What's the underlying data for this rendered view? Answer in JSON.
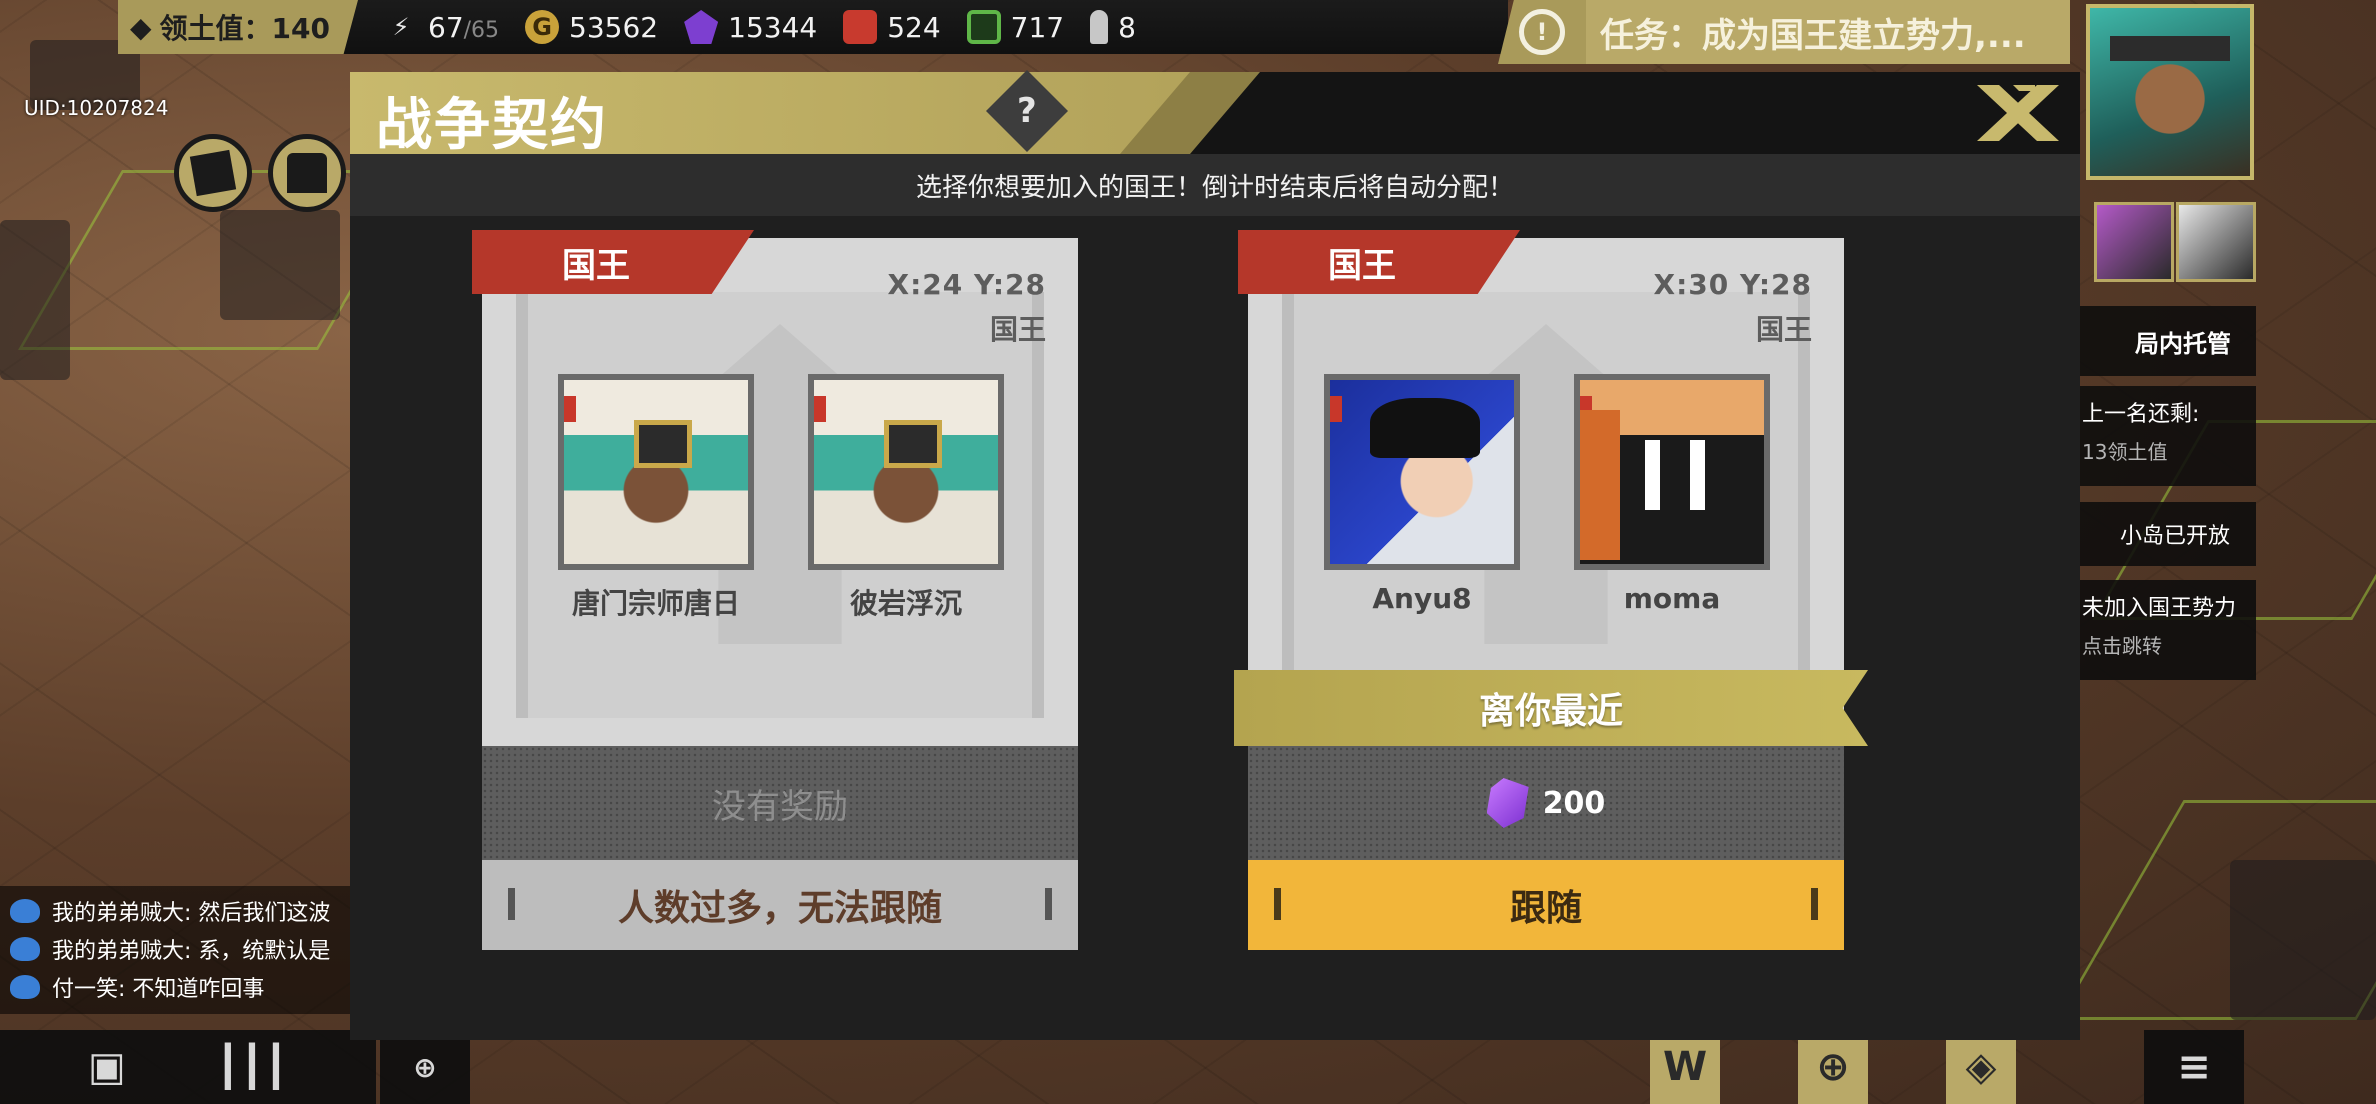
{
  "hud": {
    "territory_label": "领土值：140",
    "energy": "67",
    "energy_max": "/65",
    "gold": "53562",
    "crystal": "15344",
    "fuel": "524",
    "chip": "717",
    "ammo": "8",
    "uid": "UID:10207824",
    "mission": "任务：成为国王建立势力,..."
  },
  "side_panel": {
    "auto_manage": "局内托管",
    "last_rank_line1": "上一名还剩:",
    "last_rank_line2": "13领土值",
    "island_open": "小岛已开放",
    "not_joined_line1": "未加入国王势力",
    "not_joined_line2": "点击跳转"
  },
  "chat": [
    {
      "text": "我的弟弟贼大: 然后我们这波"
    },
    {
      "text": "我的弟弟贼大: 系，统默认是"
    },
    {
      "text": "付一笑: 不知道咋回事"
    }
  ],
  "dialog": {
    "title": "战争契约",
    "help_label": "?",
    "subtitle": "选择你想要加入的国王！倒计时结束后将自动分配！",
    "cards": [
      {
        "tag": "国王",
        "coords": "X:24  Y:28",
        "role": "国王",
        "members": [
          {
            "name": "唐门宗师唐日"
          },
          {
            "name": "彼岩浮沉"
          }
        ],
        "reward_text": "没有奖励",
        "action": "人数过多，无法跟随"
      },
      {
        "tag": "国王",
        "coords": "X:30  Y:28",
        "role": "国王",
        "members": [
          {
            "name": "Anyu8"
          },
          {
            "name": "moma"
          }
        ],
        "ribbon": "离你最近",
        "reward_amount": "200",
        "action": "跟随"
      }
    ]
  },
  "colors": {
    "accent_gold": "#c8b96d",
    "king_tag_red": "#b5372a",
    "follow_yellow": "#f2b63a"
  }
}
